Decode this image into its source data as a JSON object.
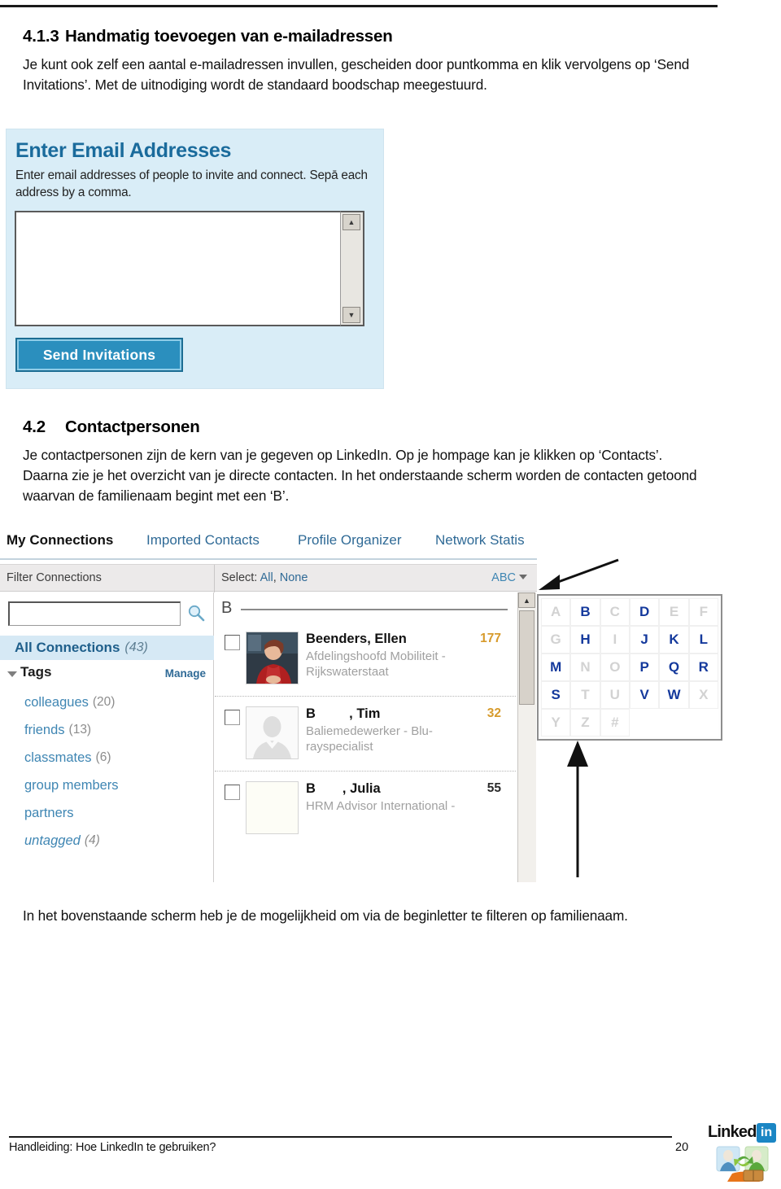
{
  "document": {
    "section_413": {
      "number": "4.1.3",
      "title": "Handmatig toevoegen van e-mailadressen",
      "paragraph": "Je kunt ook zelf een aantal e-mailadressen invullen, gescheiden door puntkomma en klik vervolgens op ‘Send Invitations’. Met de uitnodiging wordt de standaard boodschap meegestuurd."
    },
    "section_42": {
      "number": "4.2",
      "title": "Contactpersonen",
      "paragraph": "Je contactpersonen zijn de kern van je gegeven op LinkedIn. Op je hompage kan je klikken op ‘Contacts’. Daarna zie je het overzicht van je directe contacten. In het onderstaande scherm worden de contacten getoond waarvan de familienaam begint met een ‘B’."
    },
    "closing_paragraph": "In het bovenstaande scherm heb je de mogelijkheid om via de beginletter te filteren op familienaam."
  },
  "footer": {
    "text": "Handleiding: Hoe LinkedIn te gebruiken?",
    "page_number": "20",
    "logo_word": "Linked",
    "logo_in": "in"
  },
  "email_invite_screen": {
    "title": "Enter Email Addresses",
    "description": "Enter email addresses of people to invite and connect. Sepā each address by a comma.",
    "textarea_value": "",
    "textarea_placeholder": "",
    "send_button": "Send Invitations",
    "scroll_up_glyph": "▲",
    "scroll_down_glyph": "▼",
    "colors": {
      "panel_bg": "#d9edf7",
      "title": "#1a6b9c",
      "button_bg": "#2b8fbe",
      "button_border": "#1c6d93"
    }
  },
  "connections_screen": {
    "tabs": [
      {
        "label": "My Connections",
        "active": true
      },
      {
        "label": "Imported Contacts",
        "active": false
      },
      {
        "label": "Profile Organizer",
        "active": false
      },
      {
        "label": "Network Statis",
        "active": false
      }
    ],
    "filter_bar": {
      "filter_label": "Filter Connections",
      "select_label": "Select:",
      "select_all": "All",
      "select_sep": ",",
      "select_none": "None",
      "abc_label": "ABC"
    },
    "sidebar": {
      "search_value": "",
      "search_placeholder": "",
      "all_connections_label": "All Connections",
      "all_connections_count": "(43)",
      "tags_label": "Tags",
      "manage_label": "Manage",
      "tags": [
        {
          "name": "colleagues",
          "count": "(20)"
        },
        {
          "name": "friends",
          "count": "(13)"
        },
        {
          "name": "classmates",
          "count": "(6)"
        },
        {
          "name": "group members",
          "count": ""
        },
        {
          "name": "partners",
          "count": ""
        },
        {
          "name": "untagged",
          "count": "(4)"
        }
      ]
    },
    "list": {
      "letter_header": "B",
      "contacts": [
        {
          "name": "Beenders, Ellen",
          "title": "Afdelingshoofd Mobiliteit - Rijkswaterstaat",
          "degree": "177",
          "degree_color": "#d79b2c",
          "has_photo": true,
          "checked": false
        },
        {
          "name": "B     , Tim",
          "title": "Baliemedewerker - Blu-rayspecialist",
          "degree": "32",
          "degree_color": "#d79b2c",
          "has_photo": false,
          "checked": false
        },
        {
          "name": "B    , Julia",
          "title": "HRM Advisor International -",
          "degree": "55",
          "degree_color": "#2b2b2b",
          "has_photo": false,
          "checked": false
        }
      ]
    },
    "alphabet_panel": {
      "rows": [
        [
          {
            "letter": "A",
            "enabled": false
          },
          {
            "letter": "B",
            "enabled": true
          },
          {
            "letter": "C",
            "enabled": false
          },
          {
            "letter": "D",
            "enabled": true
          },
          {
            "letter": "E",
            "enabled": false
          },
          {
            "letter": "F",
            "enabled": false
          }
        ],
        [
          {
            "letter": "G",
            "enabled": false
          },
          {
            "letter": "H",
            "enabled": true
          },
          {
            "letter": "I",
            "enabled": false
          },
          {
            "letter": "J",
            "enabled": true
          },
          {
            "letter": "K",
            "enabled": true
          },
          {
            "letter": "L",
            "enabled": true
          }
        ],
        [
          {
            "letter": "M",
            "enabled": true
          },
          {
            "letter": "N",
            "enabled": false
          },
          {
            "letter": "O",
            "enabled": false
          },
          {
            "letter": "P",
            "enabled": true
          },
          {
            "letter": "Q",
            "enabled": true
          },
          {
            "letter": "R",
            "enabled": true
          }
        ],
        [
          {
            "letter": "S",
            "enabled": true
          },
          {
            "letter": "T",
            "enabled": false
          },
          {
            "letter": "U",
            "enabled": false
          },
          {
            "letter": "V",
            "enabled": true
          },
          {
            "letter": "W",
            "enabled": true
          },
          {
            "letter": "X",
            "enabled": false
          }
        ],
        [
          {
            "letter": "Y",
            "enabled": false
          },
          {
            "letter": "Z",
            "enabled": false
          },
          {
            "letter": "#",
            "enabled": false
          },
          {
            "letter": "",
            "enabled": false
          },
          {
            "letter": "",
            "enabled": false
          },
          {
            "letter": "",
            "enabled": false
          }
        ]
      ]
    },
    "scrollbar": {
      "up_glyph": "▲"
    }
  }
}
